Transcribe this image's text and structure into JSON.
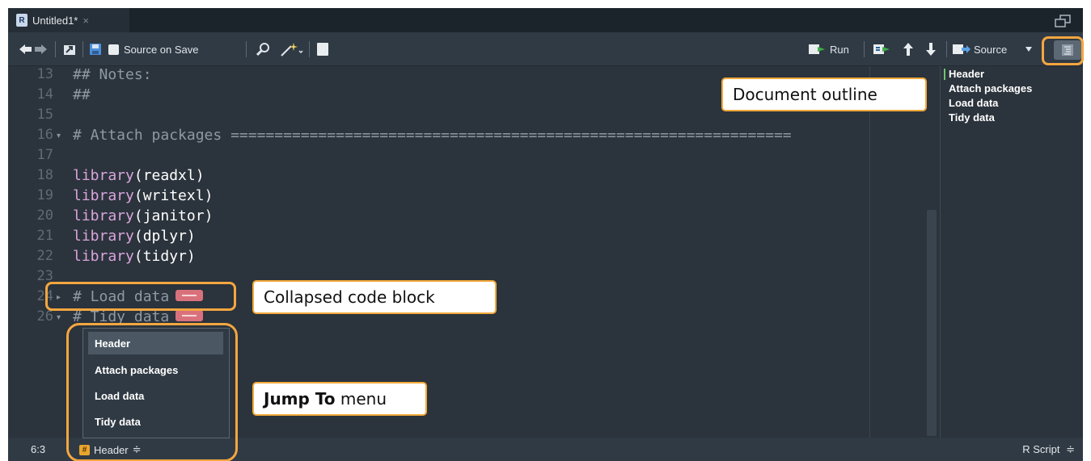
{
  "tab": {
    "title": "Untitled1*",
    "close": "×",
    "r_icon": "R"
  },
  "toolbar": {
    "source_on_save": "Source on Save",
    "run": "Run",
    "source": "Source",
    "icons": [
      "back-arrow-icon",
      "forward-arrow-icon",
      "show-in-window-icon",
      "save-icon",
      "search-icon",
      "magic-wand-icon",
      "notebook-icon",
      "run-icon",
      "rerun-icon",
      "up-arrow-icon",
      "down-arrow-icon",
      "source-icon",
      "outline-icon"
    ]
  },
  "editor": {
    "lines": [
      {
        "num": "13",
        "text": "## Notes:",
        "kind": "comment"
      },
      {
        "num": "14",
        "text": "##",
        "kind": "comment"
      },
      {
        "num": "15",
        "text": "",
        "kind": "comment"
      },
      {
        "num": "16",
        "text": "# Attach packages ================================================================",
        "kind": "comment",
        "fold": "open"
      },
      {
        "num": "17",
        "text": "",
        "kind": "comment"
      },
      {
        "num": "18",
        "fn": "library",
        "arg": "readxl",
        "kind": "call"
      },
      {
        "num": "19",
        "fn": "library",
        "arg": "writexl",
        "kind": "call"
      },
      {
        "num": "20",
        "fn": "library",
        "arg": "janitor",
        "kind": "call"
      },
      {
        "num": "21",
        "fn": "library",
        "arg": "dplyr",
        "kind": "call"
      },
      {
        "num": "22",
        "fn": "library",
        "arg": "tidyr",
        "kind": "call"
      },
      {
        "num": "23",
        "text": "",
        "kind": "comment"
      },
      {
        "num": "24",
        "text": "# Load data",
        "kind": "folded",
        "fold": "closed"
      },
      {
        "num": "26",
        "text": "# Tidy data",
        "kind": "folded",
        "fold": "open"
      }
    ]
  },
  "outline": {
    "items": [
      "Header",
      "Attach packages",
      "Load data",
      "Tidy data"
    ]
  },
  "jump_menu": {
    "items": [
      "Header",
      "Attach packages",
      "Load data",
      "Tidy data"
    ],
    "selected": "Header"
  },
  "statusbar": {
    "position": "6:3",
    "jump_label": "Header",
    "jump_arrows": "≑",
    "hash": "#",
    "file_type": "R Script",
    "type_arrows": "≑"
  },
  "callouts": {
    "outline": "Document outline",
    "collapsed": "Collapsed code block",
    "jump_bold": "Jump To",
    "jump_rest": " menu"
  },
  "colors": {
    "accent": "#f4a640",
    "comment": "#8e99a3",
    "function": "#d9a5dc",
    "fold_badge": "#d9717c"
  }
}
